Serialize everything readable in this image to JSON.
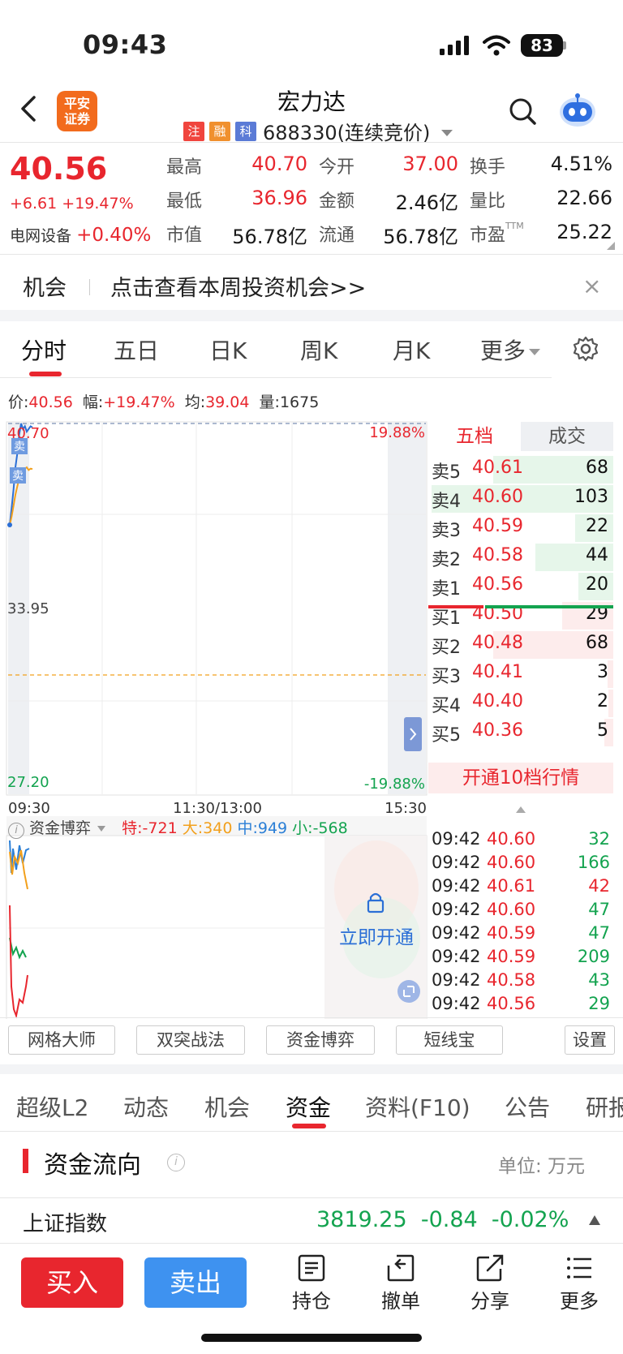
{
  "status_bar": {
    "time": "09:43",
    "battery": "83"
  },
  "header": {
    "logo_text": "平安证券",
    "stock_name": "宏力达",
    "tags": [
      "注",
      "融",
      "科"
    ],
    "tag_colors": [
      "#f0453e",
      "#f0902e",
      "#5b7bd6"
    ],
    "stock_code": "688330(连续竞价)"
  },
  "quote": {
    "price": "40.56",
    "change": "+6.61",
    "change_pct": "+19.47%",
    "sector_name": "电网设备",
    "sector_chg": "+0.40%",
    "stats": [
      {
        "label": "最高",
        "value": "40.70",
        "color": "red"
      },
      {
        "label": "今开",
        "value": "37.00",
        "color": "red"
      },
      {
        "label": "换手",
        "value": "4.51%",
        "color": "dark"
      },
      {
        "label": "最低",
        "value": "36.96",
        "color": "red"
      },
      {
        "label": "金额",
        "value": "2.46亿",
        "color": "dark"
      },
      {
        "label": "量比",
        "value": "22.66",
        "color": "dark"
      },
      {
        "label": "市值",
        "value": "56.78亿",
        "color": "dark"
      },
      {
        "label": "流通",
        "value": "56.78亿",
        "color": "dark"
      },
      {
        "label": "市盈",
        "value": "25.22",
        "color": "dark",
        "sup": "TTM"
      }
    ]
  },
  "opportunity": {
    "label": "机会",
    "text": "点击查看本周投资机会>>",
    "close": "×"
  },
  "chart_tabs": [
    {
      "label": "分时",
      "active": true
    },
    {
      "label": "五日"
    },
    {
      "label": "日K"
    },
    {
      "label": "周K"
    },
    {
      "label": "月K"
    },
    {
      "label": "更多"
    }
  ],
  "info_line": {
    "price_label": "价:",
    "price": "40.56",
    "range_label": "幅:",
    "range": "+19.47%",
    "avg_label": "均:",
    "avg": "39.04",
    "vol_label": "量:",
    "vol": "1675"
  },
  "chart_labels": {
    "top_price": "40.70",
    "mid_price": "33.95",
    "bottom_price": "27.20",
    "top_pct": "19.88%",
    "bottom_pct": "-19.88%",
    "time_start": "09:30",
    "time_mid": "11:30/13:00",
    "time_end": "15:30",
    "sell_marker": "卖"
  },
  "chart_data": {
    "type": "line",
    "title": "",
    "x": [
      "09:30",
      "09:31",
      "09:32",
      "09:33",
      "09:34",
      "09:35",
      "09:36",
      "09:37",
      "09:38",
      "09:39",
      "09:40",
      "09:41",
      "09:42"
    ],
    "series": [
      {
        "values": [
          37.0,
          37.6,
          38.3,
          39.1,
          39.6,
          40.3,
          40.7,
          40.5,
          40.6,
          40.4,
          40.5,
          40.6,
          40.56
        ],
        "color": "#2b6fd6"
      },
      {
        "values": [
          37.0,
          37.3,
          37.7,
          38.1,
          38.4,
          38.7,
          38.9,
          39.0,
          39.05,
          39.1,
          39.0,
          39.05,
          39.04
        ],
        "color": "#f2a01c"
      }
    ],
    "ylim": [
      27.2,
      40.7
    ],
    "y_pct_range": [
      "-19.88%",
      "19.88%"
    ],
    "prev_close": 33.95
  },
  "order_book": {
    "tabs": [
      "五档",
      "成交"
    ],
    "sells": [
      {
        "label": "卖5",
        "price": "40.61",
        "vol": "68",
        "pct": 0.66
      },
      {
        "label": "卖4",
        "price": "40.60",
        "vol": "103",
        "pct": 1.0
      },
      {
        "label": "卖3",
        "price": "40.59",
        "vol": "22",
        "pct": 0.21
      },
      {
        "label": "卖2",
        "price": "40.58",
        "vol": "44",
        "pct": 0.43
      },
      {
        "label": "卖1",
        "price": "40.56",
        "vol": "20",
        "pct": 0.19
      }
    ],
    "buys": [
      {
        "label": "买1",
        "price": "40.50",
        "vol": "29",
        "pct": 0.28
      },
      {
        "label": "买2",
        "price": "40.48",
        "vol": "68",
        "pct": 0.66
      },
      {
        "label": "买3",
        "price": "40.41",
        "vol": "3",
        "pct": 0.03
      },
      {
        "label": "买4",
        "price": "40.40",
        "vol": "2",
        "pct": 0.02
      },
      {
        "label": "买5",
        "price": "40.36",
        "vol": "5",
        "pct": 0.05
      }
    ],
    "upgrade_text": "开通10档行情"
  },
  "ticks": [
    {
      "time": "09:42",
      "price": "40.60",
      "vol": "32",
      "vol_color": "green"
    },
    {
      "time": "09:42",
      "price": "40.60",
      "vol": "166",
      "vol_color": "green"
    },
    {
      "time": "09:42",
      "price": "40.61",
      "vol": "42",
      "vol_color": "red"
    },
    {
      "time": "09:42",
      "price": "40.60",
      "vol": "47",
      "vol_color": "green"
    },
    {
      "time": "09:42",
      "price": "40.59",
      "vol": "47",
      "vol_color": "green"
    },
    {
      "time": "09:42",
      "price": "40.59",
      "vol": "209",
      "vol_color": "green"
    },
    {
      "time": "09:42",
      "price": "40.58",
      "vol": "43",
      "vol_color": "green"
    },
    {
      "time": "09:42",
      "price": "40.56",
      "vol": "29",
      "vol_color": "green"
    }
  ],
  "funds_game": {
    "label": "资金博弈",
    "special": "特:-721",
    "large": "大:340",
    "medium": "中:949",
    "small": "小:-568",
    "lock_text": "立即开通"
  },
  "tools": [
    "网格大师",
    "双突战法",
    "资金博弈",
    "短线宝",
    "设置"
  ],
  "bottom_tabs": [
    "超级L2",
    "动态",
    "机会",
    "资金",
    "资料(F10)",
    "公告",
    "研报"
  ],
  "funds_flow": {
    "title": "资金流向",
    "unit": "单位: 万元"
  },
  "index": {
    "name": "上证指数",
    "value": "3819.25",
    "change": "-0.84",
    "pct": "-0.02%"
  },
  "actions": {
    "buy": "买入",
    "sell": "卖出",
    "items": [
      {
        "label": "持仓",
        "icon": "position-icon"
      },
      {
        "label": "撤单",
        "icon": "cancel-order-icon"
      },
      {
        "label": "分享",
        "icon": "share-icon"
      },
      {
        "label": "更多",
        "icon": "more-icon"
      }
    ]
  }
}
